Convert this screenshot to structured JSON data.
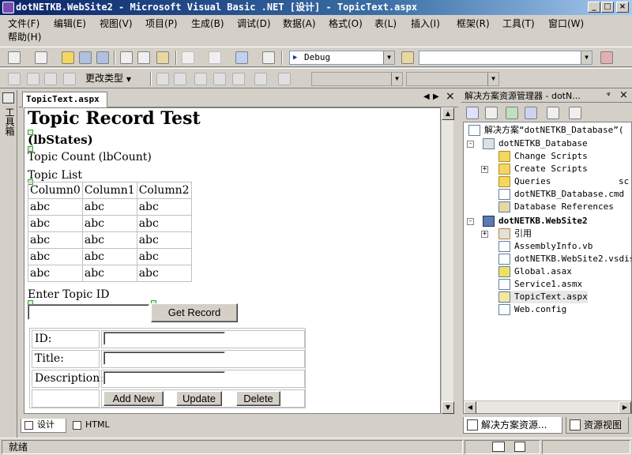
{
  "window": {
    "title": "dotNETKB.WebSite2 - Microsoft Visual Basic .NET [设计] - TopicText.aspx",
    "minimize": "_",
    "maximize": "□",
    "close": "×"
  },
  "menu": {
    "row1": [
      "文件(F)",
      "编辑(E)",
      "视图(V)",
      "项目(P)",
      "生成(B)",
      "调试(D)",
      "数据(A)",
      "格式(O)",
      "表(L)",
      "插入(I)",
      "框架(R)",
      "工具(T)",
      "窗口(W)"
    ],
    "row2": [
      "帮助(H)"
    ]
  },
  "toolbar": {
    "config_value": "Debug",
    "change_type_label": "更改类型",
    "dropdown_arrow": "▼"
  },
  "toolbox": {
    "label": "工具箱"
  },
  "document": {
    "tab_label": "TopicText.aspx",
    "nav_prev": "◀",
    "nav_next": "▶",
    "close": "×",
    "scroll_up": "▲",
    "scroll_down": "▼",
    "heading": "Topic Record Test",
    "lb_states": "(lbStates)",
    "topic_count": "Topic Count (lbCount)",
    "topic_list": "Topic List",
    "grid": {
      "columns": [
        "Column0",
        "Column1",
        "Column2"
      ],
      "rows": [
        [
          "abc",
          "abc",
          "abc"
        ],
        [
          "abc",
          "abc",
          "abc"
        ],
        [
          "abc",
          "abc",
          "abc"
        ],
        [
          "abc",
          "abc",
          "abc"
        ],
        [
          "abc",
          "abc",
          "abc"
        ]
      ]
    },
    "enter_topic_label": "Enter Topic ID",
    "get_record_button": "Get Record",
    "form": {
      "id_label": "ID:",
      "title_label": "Title:",
      "description_label": "Description:",
      "add_new_button": "Add New",
      "update_button": "Update",
      "delete_button": "Delete"
    },
    "view_tabs": {
      "design": "设计",
      "html": "HTML"
    }
  },
  "solution_explorer": {
    "title": "解决方案资源管理器 - dotN...",
    "pin": "ᵠ",
    "close": "×",
    "tree": [
      {
        "label": "解决方案“dotNETKB_Database”(",
        "level": 0,
        "bold": false
      },
      {
        "label": "dotNETKB_Database",
        "level": 1,
        "bold": false
      },
      {
        "label": "Change Scripts",
        "level": 2,
        "bold": false
      },
      {
        "label": "Create Scripts",
        "level": 2,
        "bold": false
      },
      {
        "label": "Queries",
        "level": 2,
        "bold": false
      },
      {
        "label": "dotNETKB_Database.cmd",
        "level": 2,
        "bold": false
      },
      {
        "label": "Database References",
        "level": 2,
        "bold": false
      },
      {
        "label": "dotNETKB.WebSite2",
        "level": 1,
        "bold": true
      },
      {
        "label": "引用",
        "level": 2,
        "bold": false
      },
      {
        "label": "AssemblyInfo.vb",
        "level": 2,
        "bold": false
      },
      {
        "label": "dotNETKB.WebSite2.vsdisco",
        "level": 2,
        "bold": false
      },
      {
        "label": "Global.asax",
        "level": 2,
        "bold": false
      },
      {
        "label": "Service1.asmx",
        "level": 2,
        "bold": false
      },
      {
        "label": "TopicText.aspx",
        "level": 2,
        "bold": false
      },
      {
        "label": "Web.config",
        "level": 2,
        "bold": false
      }
    ],
    "tree_extra": "sc",
    "tab_solution": "解决方案资源...",
    "tab_resource": "资源视图"
  },
  "statusbar": {
    "text": "就绪"
  }
}
